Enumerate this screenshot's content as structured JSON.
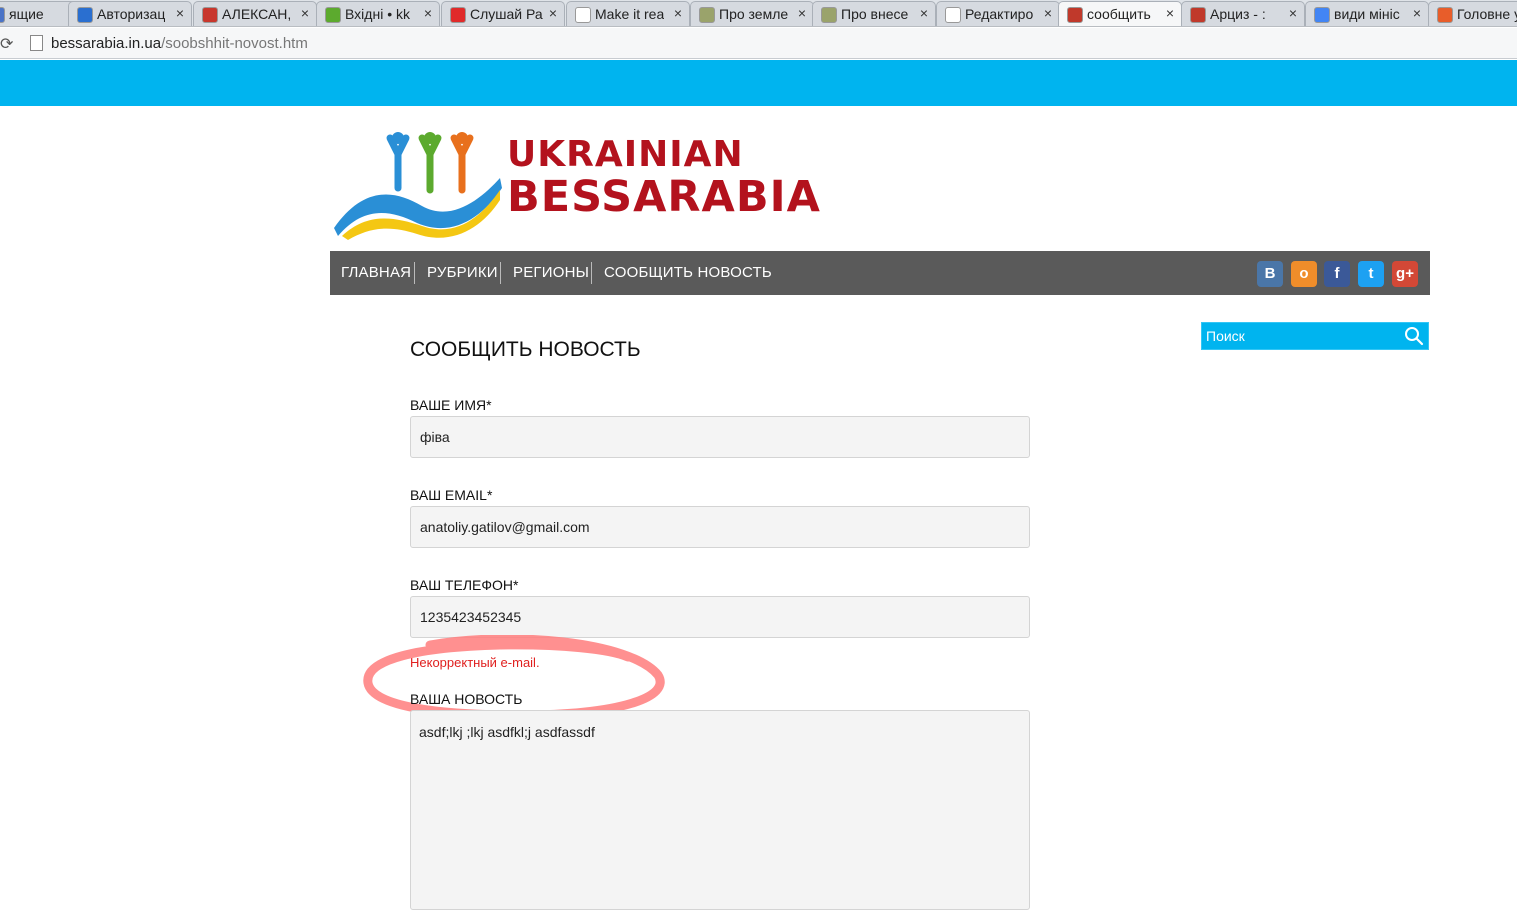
{
  "browser": {
    "tabs": [
      {
        "title": "ящие",
        "icon_color": "#4a73c7",
        "active": false
      },
      {
        "title": "Авторизац",
        "icon_color": "#2a6fd0",
        "active": false
      },
      {
        "title": "АЛЕКСАН,",
        "icon_color": "#c8372d",
        "active": false
      },
      {
        "title": "Вхідні • kk",
        "icon_color": "#5caa2e",
        "active": false
      },
      {
        "title": "Слушай Ра",
        "icon_color": "#e02a2a",
        "active": false
      },
      {
        "title": "Make it rea",
        "icon_color": "#ffffff",
        "active": false
      },
      {
        "title": "Про земле",
        "icon_color": "#9aa36b",
        "active": false
      },
      {
        "title": "Про внесе",
        "icon_color": "#9aa36b",
        "active": false
      },
      {
        "title": "Редактиро",
        "icon_color": "#ffffff",
        "active": false
      },
      {
        "title": "сообщить",
        "icon_color": "#c0392b",
        "active": true
      },
      {
        "title": "Арциз - :",
        "icon_color": "#c0392b",
        "active": false
      },
      {
        "title": "види мініс",
        "icon_color": "#4285f4",
        "active": false
      },
      {
        "title": "Головне у",
        "icon_color": "#e85d2a",
        "active": false
      }
    ],
    "url_host": "bessarabia.in.ua",
    "url_path": "/soobshhit-novost.htm"
  },
  "site": {
    "logo_line1": "UKRAINIAN",
    "logo_line2": "BESSARABIA",
    "brand_color": "#b3121d",
    "accent_color": "#00b4ef"
  },
  "nav": {
    "items": [
      "ГЛАВНАЯ",
      "РУБРИКИ",
      "РЕГИОНЫ",
      "СООБЩИТЬ НОВОСТЬ"
    ],
    "social": [
      {
        "name": "vk",
        "glyph": "В",
        "color": "#4a76a8"
      },
      {
        "name": "odnoklassniki",
        "glyph": "о",
        "color": "#f08d2a"
      },
      {
        "name": "facebook",
        "glyph": "f",
        "color": "#3b5998"
      },
      {
        "name": "twitter",
        "glyph": "t",
        "color": "#1da1f2"
      },
      {
        "name": "google-plus",
        "glyph": "g+",
        "color": "#d34836"
      }
    ]
  },
  "search": {
    "placeholder": "Поиск"
  },
  "form": {
    "title": "СООБЩИТЬ НОВОСТЬ",
    "name_label": "ВАШЕ ИМЯ*",
    "name_value": "фіва",
    "email_label": "ВАШ EMAIL*",
    "email_value": "anatoliy.gatilov@gmail.com",
    "phone_label": "ВАШ ТЕЛЕФОН*",
    "phone_value": "1235423452345",
    "error": "Некорректный e-mail.",
    "news_label": "ВАША НОВОСТЬ",
    "news_value": "asdf;lkj ;lkj asdfkl;j asdfassdf"
  }
}
